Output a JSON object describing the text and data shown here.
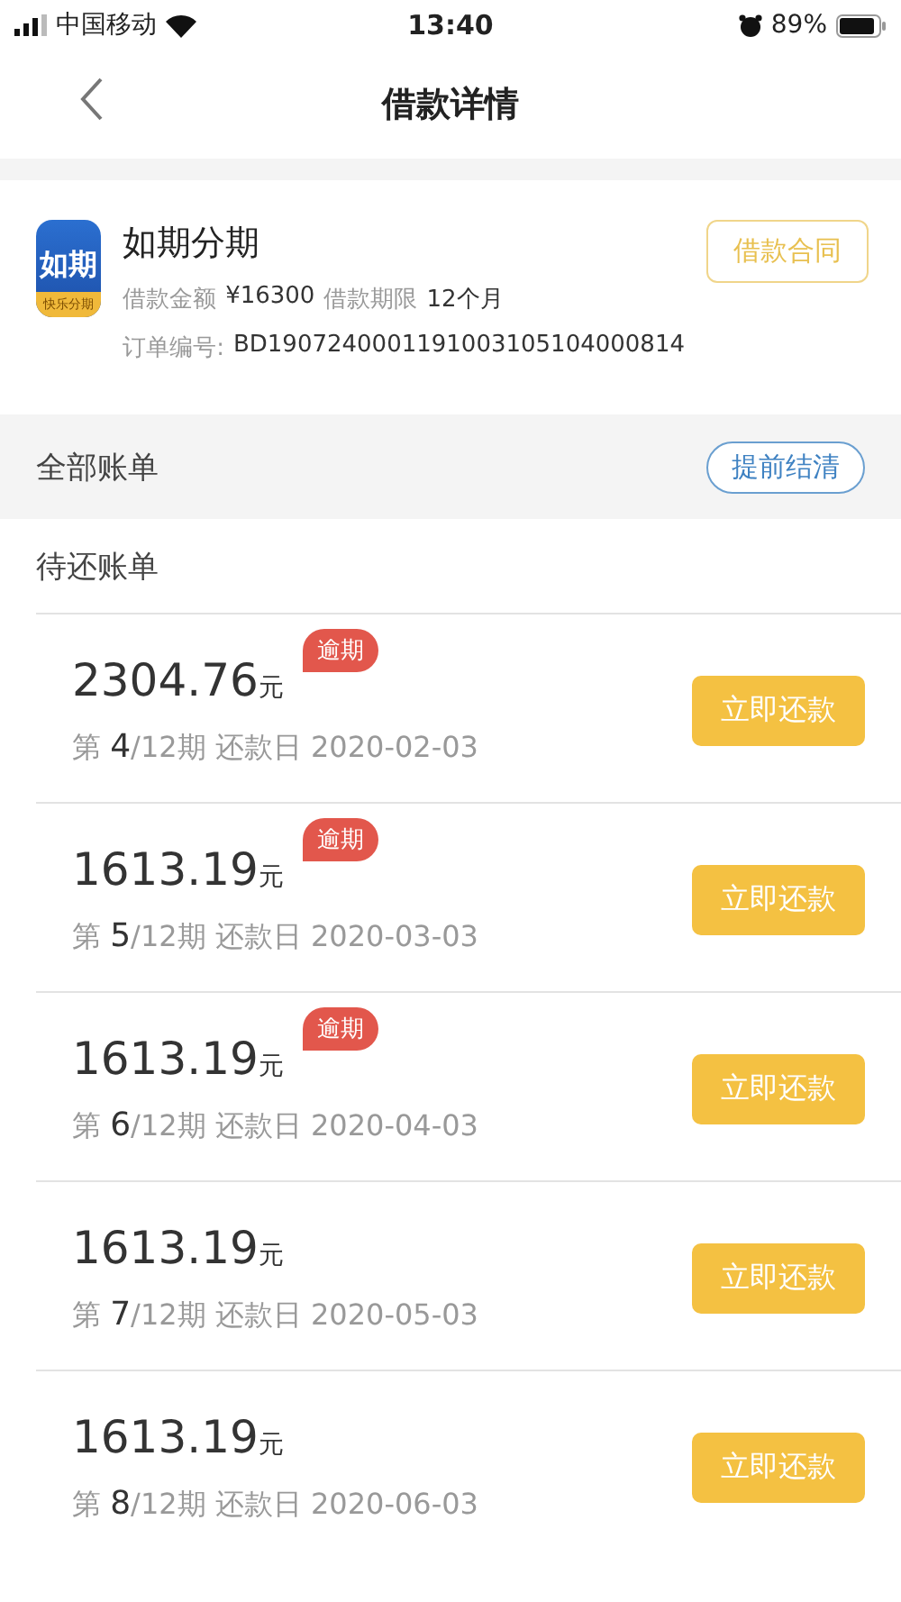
{
  "status_bar": {
    "carrier": "中国移动",
    "time": "13:40",
    "battery": "89%"
  },
  "nav": {
    "title": "借款详情"
  },
  "loan": {
    "logo_text": "如期",
    "logo_sub": "快乐分期",
    "name": "如期分期",
    "amount_label": "借款金额",
    "amount": "¥16300",
    "term_label": "借款期限",
    "term": "12个月",
    "order_label": "订单编号:",
    "order_no": "BD1907240001191003105104000814",
    "contract_button": "借款合同"
  },
  "all_bills": {
    "title": "全部账单",
    "settle_button": "提前结清"
  },
  "pending": {
    "title": "待还账单"
  },
  "bills": [
    {
      "amount": "2304.76",
      "unit": "元",
      "badge": "逾期",
      "prefix": "第",
      "period": "4",
      "rest": "/12期 还款日 2020-02-03",
      "button": "立即还款"
    },
    {
      "amount": "1613.19",
      "unit": "元",
      "badge": "逾期",
      "prefix": "第",
      "period": "5",
      "rest": "/12期 还款日 2020-03-03",
      "button": "立即还款"
    },
    {
      "amount": "1613.19",
      "unit": "元",
      "badge": "逾期",
      "prefix": "第",
      "period": "6",
      "rest": "/12期 还款日 2020-04-03",
      "button": "立即还款"
    },
    {
      "amount": "1613.19",
      "unit": "元",
      "prefix": "第",
      "period": "7",
      "rest": "/12期 还款日 2020-05-03",
      "button": "立即还款"
    },
    {
      "amount": "1613.19",
      "unit": "元",
      "prefix": "第",
      "period": "8",
      "rest": "/12期 还款日 2020-06-03",
      "button": "立即还款"
    }
  ]
}
